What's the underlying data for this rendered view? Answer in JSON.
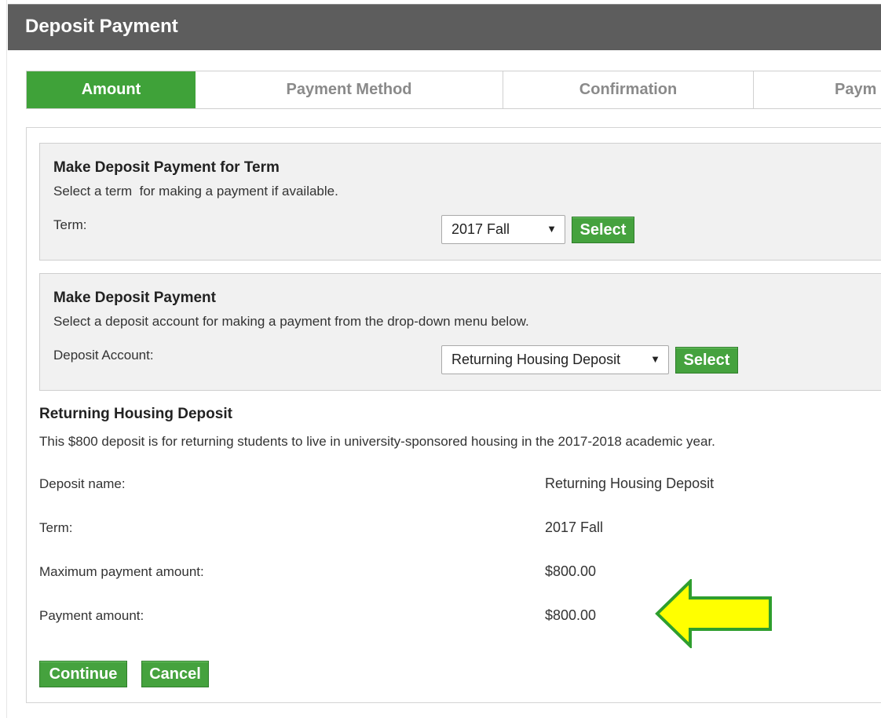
{
  "header": {
    "title": "Deposit Payment"
  },
  "steps": [
    {
      "label": "Amount",
      "active": true
    },
    {
      "label": "Payment Method",
      "active": false
    },
    {
      "label": "Confirmation",
      "active": false
    },
    {
      "label": "Paym",
      "active": false
    }
  ],
  "term_panel": {
    "title": "Make Deposit Payment for Term",
    "description": "Select a term  for making a payment if available.",
    "label": "Term:",
    "selected": "2017 Fall",
    "button": "Select"
  },
  "deposit_panel": {
    "title": "Make Deposit Payment",
    "description": "Select a deposit account for making a payment from the drop-down menu below.",
    "label": "Deposit Account:",
    "selected": "Returning Housing Deposit",
    "button": "Select"
  },
  "details": {
    "title": "Returning Housing Deposit",
    "description": "This $800 deposit is for returning students to live in university-sponsored housing in the 2017-2018 academic year.",
    "rows": [
      {
        "label": "Deposit name:",
        "value": "Returning Housing Deposit"
      },
      {
        "label": "Term:",
        "value": "2017 Fall"
      },
      {
        "label": "Maximum payment amount:",
        "value": "$800.00"
      },
      {
        "label": "Payment amount:",
        "value": "$800.00"
      }
    ]
  },
  "actions": {
    "continue": "Continue",
    "cancel": "Cancel"
  },
  "colors": {
    "header_bg": "#5d5d5d",
    "accent_green": "#3fa239",
    "panel_bg": "#f1f1f1",
    "arrow_fill": "#ffff00",
    "arrow_stroke": "#2e9e2e"
  },
  "icons": {
    "dropdown": "chevron-down-icon",
    "pointer": "arrow-left-icon"
  }
}
